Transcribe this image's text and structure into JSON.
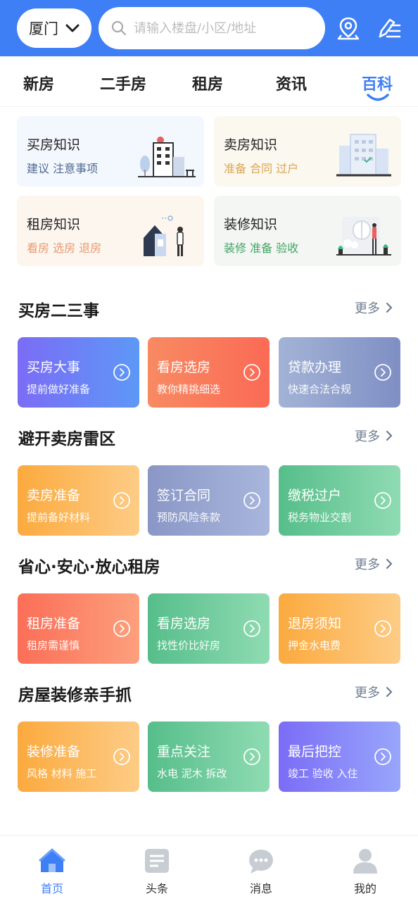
{
  "header": {
    "city": "厦门",
    "search_placeholder": "请输入楼盘/小区/地址"
  },
  "tabs": [
    {
      "label": "新房"
    },
    {
      "label": "二手房"
    },
    {
      "label": "租房"
    },
    {
      "label": "资讯"
    },
    {
      "label": "百科",
      "active": true
    }
  ],
  "knowledge": [
    {
      "title": "买房知识",
      "subtitle": "建议 注意事项",
      "bg": "#f3f7fe",
      "subcolor": "#4f6a92"
    },
    {
      "title": "卖房知识",
      "subtitle": "准备 合同 过户",
      "bg": "#fbf8ef",
      "subcolor": "#dca452"
    },
    {
      "title": "租房知识",
      "subtitle": "看房 选房 退房",
      "bg": "#fdf6ef",
      "subcolor": "#e89a70"
    },
    {
      "title": "装修知识",
      "subtitle": "装修 准备 验收",
      "bg": "#f3f6f3",
      "subcolor": "#43a563"
    }
  ],
  "sections": [
    {
      "title": "买房二三事",
      "more": "更多",
      "cards": [
        {
          "title": "买房大事",
          "subtitle": "提前做好准备"
        },
        {
          "title": "看房选房",
          "subtitle": "教你精挑细选"
        },
        {
          "title": "贷款办理",
          "subtitle": "快速合法合规"
        }
      ]
    },
    {
      "title": "避开卖房雷区",
      "more": "更多",
      "cards": [
        {
          "title": "卖房准备",
          "subtitle": "提前备好材料"
        },
        {
          "title": "签订合同",
          "subtitle": "预防风险条款"
        },
        {
          "title": "缴税过户",
          "subtitle": "税务物业交割"
        }
      ]
    },
    {
      "title": "省心·安心·放心租房",
      "more": "更多",
      "cards": [
        {
          "title": "租房准备",
          "subtitle": "租房需谨慎"
        },
        {
          "title": "看房选房",
          "subtitle": "找性价比好房"
        },
        {
          "title": "退房须知",
          "subtitle": "押金水电费"
        }
      ]
    },
    {
      "title": "房屋装修亲手抓",
      "more": "更多",
      "cards": [
        {
          "title": "装修准备",
          "subtitle": "风格 材料 施工"
        },
        {
          "title": "重点关注",
          "subtitle": "水电 泥木 拆改"
        },
        {
          "title": "最后把控",
          "subtitle": "竣工 验收 入住"
        }
      ]
    }
  ],
  "bottom_nav": [
    {
      "label": "首页",
      "icon": "home-icon",
      "active": true
    },
    {
      "label": "头条",
      "icon": "headlines-icon"
    },
    {
      "label": "消息",
      "icon": "message-icon"
    },
    {
      "label": "我的",
      "icon": "profile-icon"
    }
  ],
  "colors": {
    "accent": "#3f7ff5"
  }
}
